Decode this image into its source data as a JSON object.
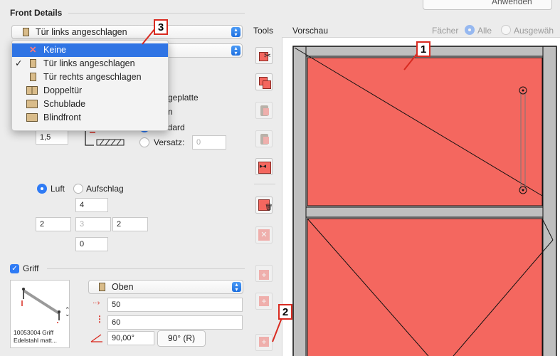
{
  "left_panel": {
    "title": "Front Details",
    "front_type_select": "Tür links angeschlagen",
    "partial_label_1": "geplatte",
    "partial_label_2": "n",
    "partial_label_3": "tandard",
    "versatz_label": "Versatz:",
    "versatz_value": "0",
    "thickness_value": "1,5",
    "luft_label": "Luft",
    "aufschlag_label": "Aufschlag",
    "gap_top": "4",
    "gap_left": "2",
    "gap_middle": "3",
    "gap_right": "2",
    "gap_bottom": "0",
    "griff_label": "Griff",
    "griff_position": "Oben",
    "griff_value_1": "50",
    "griff_value_2": "60",
    "griff_angle": "90,00°",
    "griff_angle_button": "90° (R)",
    "handle_caption_1": "10053004 Griff",
    "handle_caption_2": "Edelstahl matt..."
  },
  "dropdown_menu": {
    "items": [
      {
        "label": "Keine",
        "icon": "x-icon",
        "selected": true,
        "checked": false
      },
      {
        "label": "Tür links angeschlagen",
        "icon": "door-left-icon",
        "selected": false,
        "checked": true
      },
      {
        "label": "Tür rechts angeschlagen",
        "icon": "door-right-icon",
        "selected": false,
        "checked": false
      },
      {
        "label": "Doppeltür",
        "icon": "double-door-icon",
        "selected": false,
        "checked": false
      },
      {
        "label": "Schublade",
        "icon": "drawer-icon",
        "selected": false,
        "checked": false
      },
      {
        "label": "Blindfront",
        "icon": "blind-front-icon",
        "selected": false,
        "checked": false
      }
    ]
  },
  "tools": {
    "title": "Tools",
    "icons": [
      "cut-front-icon",
      "copy-front-icon",
      "paste-front-icon",
      "paste-special-icon",
      "mirror-icon",
      "delete-grid-icon",
      "remove-icon",
      "add-above-icon",
      "add-icon",
      "add-below-icon"
    ]
  },
  "preview": {
    "title": "Vorschau",
    "faecher_label": "Fächer",
    "alle_label": "Alle",
    "ausgewaehlt_label": "Ausgewäh",
    "top_button_partial": "Anwenden",
    "front_color": "#f4675f"
  },
  "callouts": {
    "c1": "1",
    "c2": "2",
    "c3": "3"
  },
  "colors": {
    "accent": "#2f74e4",
    "front": "#f4675f",
    "callout_border": "#d92b21"
  }
}
